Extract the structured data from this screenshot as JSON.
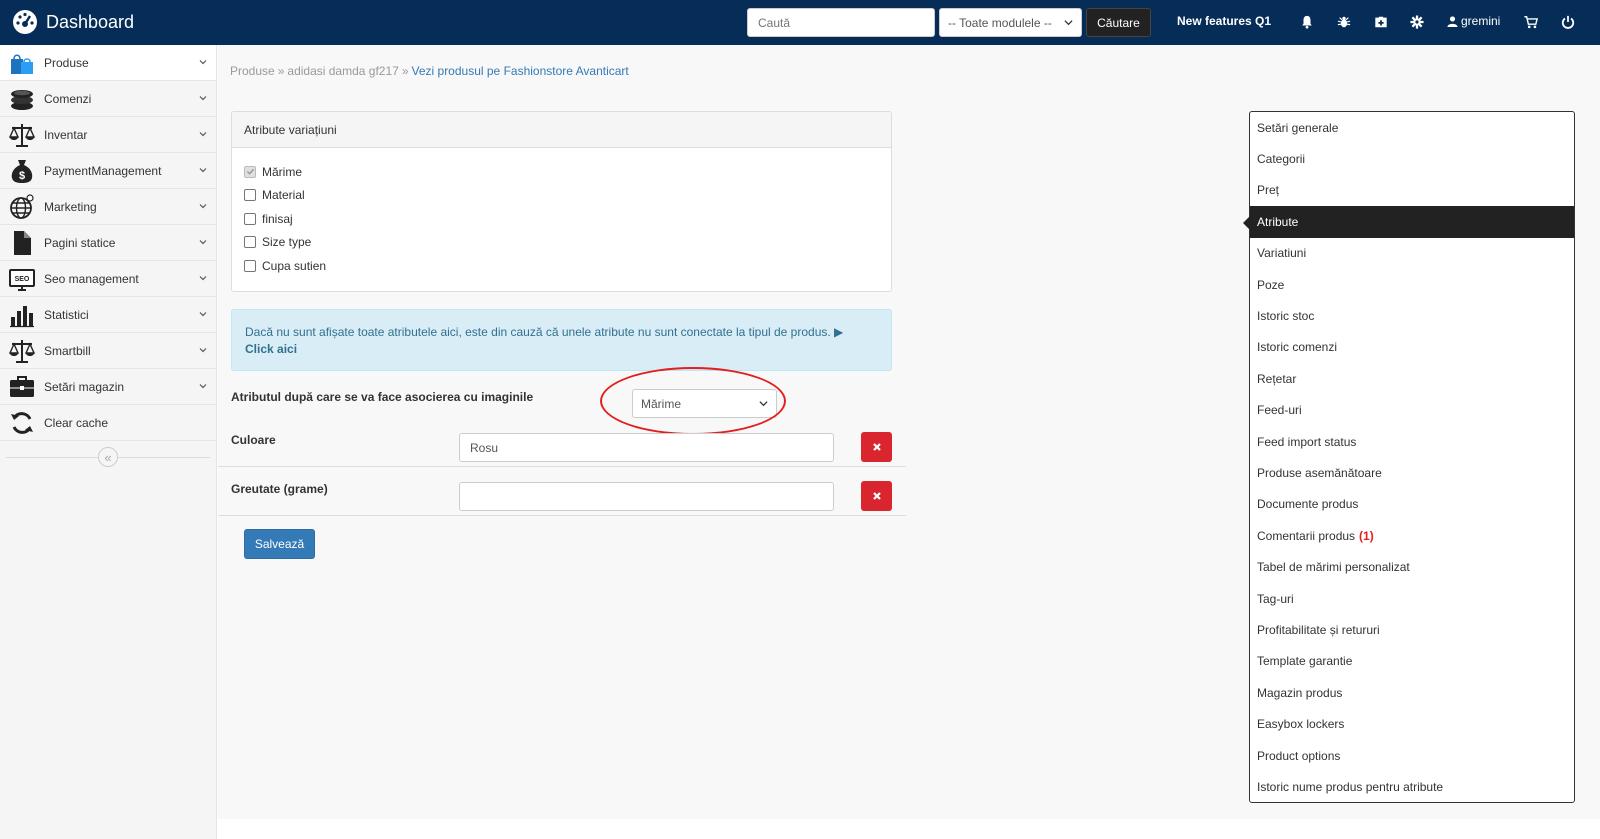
{
  "header": {
    "title": "Dashboard",
    "search_placeholder": "Caută",
    "module_select": "-- Toate modulele --",
    "search_button": "Căutare",
    "new_features": "New features Q1",
    "username": "gremini"
  },
  "sidebar": {
    "items": [
      {
        "label": "Produse",
        "icon": "shopping-bags-icon"
      },
      {
        "label": "Comenzi",
        "icon": "coins-icon"
      },
      {
        "label": "Inventar",
        "icon": "scale-icon"
      },
      {
        "label": "PaymentManagement",
        "icon": "money-bag-icon"
      },
      {
        "label": "Marketing",
        "icon": "globe-icon"
      },
      {
        "label": "Pagini statice",
        "icon": "file-icon"
      },
      {
        "label": "Seo management",
        "icon": "seo-monitor-icon"
      },
      {
        "label": "Statistici",
        "icon": "bar-chart-icon"
      },
      {
        "label": "Smartbill",
        "icon": "scale-icon"
      },
      {
        "label": "Setări magazin",
        "icon": "briefcase-icon"
      },
      {
        "label": "Clear cache",
        "icon": "refresh-icon"
      }
    ]
  },
  "breadcrumb": {
    "root": "Produse",
    "product": "adidasi damda gf217",
    "link": "Vezi produsul pe Fashionstore Avanticart",
    "separator": "»"
  },
  "variations_panel": {
    "title": "Atribute variațiuni",
    "options": [
      {
        "label": "Mărime",
        "checked": true
      },
      {
        "label": "Material",
        "checked": false
      },
      {
        "label": "finisaj",
        "checked": false
      },
      {
        "label": "Size type",
        "checked": false
      },
      {
        "label": "Cupa sutien",
        "checked": false
      }
    ]
  },
  "info_alert": {
    "text": "Dacă nu sunt afișate toate atributele aici, este din cauză că unele atribute nu sunt conectate la tipul de produs. ▶",
    "link": "Click aici"
  },
  "image_association": {
    "label": "Atributul după care se va face asocierea cu imaginile",
    "selected": "Mărime"
  },
  "attributes": [
    {
      "label": "Culoare",
      "value": "Rosu"
    },
    {
      "label": "Greutate (grame)",
      "value": ""
    }
  ],
  "save_button": "Salvează",
  "right_menu": {
    "items": [
      {
        "label": "Setări generale"
      },
      {
        "label": "Categorii"
      },
      {
        "label": "Preț"
      },
      {
        "label": "Atribute",
        "active": true
      },
      {
        "label": "Variatiuni"
      },
      {
        "label": "Poze"
      },
      {
        "label": "Istoric stoc"
      },
      {
        "label": "Istoric comenzi"
      },
      {
        "label": "Rețetar"
      },
      {
        "label": "Feed-uri"
      },
      {
        "label": "Feed import status"
      },
      {
        "label": "Produse asemănătoare"
      },
      {
        "label": "Documente produs"
      },
      {
        "label": "Comentarii produs",
        "badge": "(1)"
      },
      {
        "label": "Tabel de mărimi personalizat"
      },
      {
        "label": "Tag-uri"
      },
      {
        "label": "Profitabilitate și retururi"
      },
      {
        "label": "Template garantie"
      },
      {
        "label": "Magazin produs"
      },
      {
        "label": "Easybox lockers"
      },
      {
        "label": "Product options"
      },
      {
        "label": "Istoric nume produs pentru atribute"
      }
    ]
  },
  "colors": {
    "topbar": "#062d57",
    "accent": "#337ab7",
    "danger": "#d9262e",
    "highlight": "#e21f1f"
  }
}
